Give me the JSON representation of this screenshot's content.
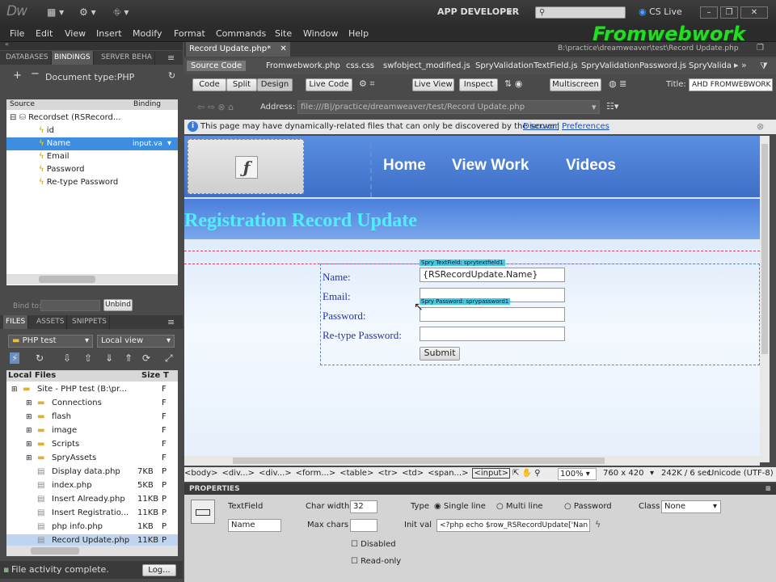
{
  "app": {
    "logo": "Dw",
    "workspace": "APP DEVELOPER",
    "cslive": "CS Live",
    "search_placeholder": ""
  },
  "menu": [
    "File",
    "Edit",
    "View",
    "Insert",
    "Modify",
    "Format",
    "Commands",
    "Site",
    "Window",
    "Help"
  ],
  "watermark": "Fromwebwork",
  "bindings": {
    "tabs": [
      "DATABASES",
      "BINDINGS",
      "SERVER BEHA"
    ],
    "doc_type": "Document type:PHP",
    "col_source": "Source",
    "col_binding": "Binding",
    "items": [
      {
        "label": "Recordset (RSRecord...",
        "binding": ""
      },
      {
        "label": "id",
        "binding": ""
      },
      {
        "label": "Name",
        "binding": "input.va"
      },
      {
        "label": "Email",
        "binding": ""
      },
      {
        "label": "Password",
        "binding": ""
      },
      {
        "label": "Re-type Password",
        "binding": ""
      }
    ],
    "bind_to": "Bind to:",
    "unbind": "Unbind"
  },
  "files": {
    "tabs": [
      "FILES",
      "ASSETS",
      "SNIPPETS"
    ],
    "site_select": "PHP test",
    "view_select": "Local view",
    "col_name": "Local Files",
    "col_size": "Size",
    "col_type": "T",
    "items": [
      {
        "name": "Site - PHP test (B:\\pr...",
        "size": "",
        "type": "F",
        "indent": 0
      },
      {
        "name": "Connections",
        "size": "",
        "type": "F",
        "indent": 1
      },
      {
        "name": "flash",
        "size": "",
        "type": "F",
        "indent": 1
      },
      {
        "name": "image",
        "size": "",
        "type": "F",
        "indent": 1
      },
      {
        "name": "Scripts",
        "size": "",
        "type": "F",
        "indent": 1
      },
      {
        "name": "SpryAssets",
        "size": "",
        "type": "F",
        "indent": 1
      },
      {
        "name": "Display data.php",
        "size": "7KB",
        "type": "P",
        "indent": 1
      },
      {
        "name": "index.php",
        "size": "5KB",
        "type": "P",
        "indent": 1
      },
      {
        "name": "Insert Already.php",
        "size": "11KB",
        "type": "P",
        "indent": 1
      },
      {
        "name": "Insert Registratio...",
        "size": "11KB",
        "type": "P",
        "indent": 1
      },
      {
        "name": "php info.php",
        "size": "1KB",
        "type": "P",
        "indent": 1
      },
      {
        "name": "Record Update.php",
        "size": "11KB",
        "type": "P",
        "indent": 1
      }
    ],
    "status": "File activity complete.",
    "log": "Log..."
  },
  "document": {
    "tab": "Record Update.php*",
    "path": "B:\\practice\\dreamweaver\\test\\Record Update.php",
    "related": [
      "Source Code",
      "Fromwebwork.php",
      "css.css",
      "swfobject_modified.js",
      "SpryValidationTextField.js",
      "SpryValidationPassword.js",
      "SpryValida"
    ],
    "toolbar": {
      "code": "Code",
      "split": "Split",
      "design": "Design",
      "live_code": "Live Code",
      "live_view": "Live View",
      "inspect": "Inspect",
      "multiscreen": "Multiscreen",
      "title_label": "Title:",
      "title_value": "AHD FROMWEBWORK"
    },
    "address_label": "Address:",
    "address": "file:///B|/practice/dreamweaver/test/Record Update.php",
    "info": "This page may have dynamically-related files that can only be discovered by the server.",
    "discover": "Discover",
    "preferences": "Preferences",
    "nav": [
      "Home",
      "View Work",
      "Videos"
    ],
    "heading": "Registration Record Update",
    "form": {
      "labels": [
        "Name:",
        "Email:",
        "Password:",
        "Re-type Password:"
      ],
      "name_value": "{RSRecordUpdate.Name}",
      "spry1": "Spry TextField: sprytextfield1",
      "spry2": "Spry Password: sprypassword1",
      "submit": "Submit"
    },
    "tagbar": [
      "<body>",
      "<div...>",
      "<div...>",
      "<form...>",
      "<table>",
      "<tr>",
      "<td>",
      "<span...>",
      "<input>"
    ],
    "zoom": "100%",
    "size": "760 x 420",
    "weight": "242K / 6 sec",
    "encoding": "Unicode (UTF-8)"
  },
  "properties": {
    "title": "PROPERTIES",
    "element": "TextField",
    "name": "Name",
    "char_width_label": "Char width",
    "char_width": "32",
    "max_chars_label": "Max chars",
    "max_chars": "",
    "type_label": "Type",
    "type_options": [
      "Single line",
      "Multi line",
      "Password"
    ],
    "type_selected": "Single line",
    "init_val_label": "Init val",
    "init_val": "<?php echo $row_RSRecordUpdate['Nan",
    "class_label": "Class",
    "class_value": "None",
    "disabled": "Disabled",
    "readonly": "Read-only"
  }
}
